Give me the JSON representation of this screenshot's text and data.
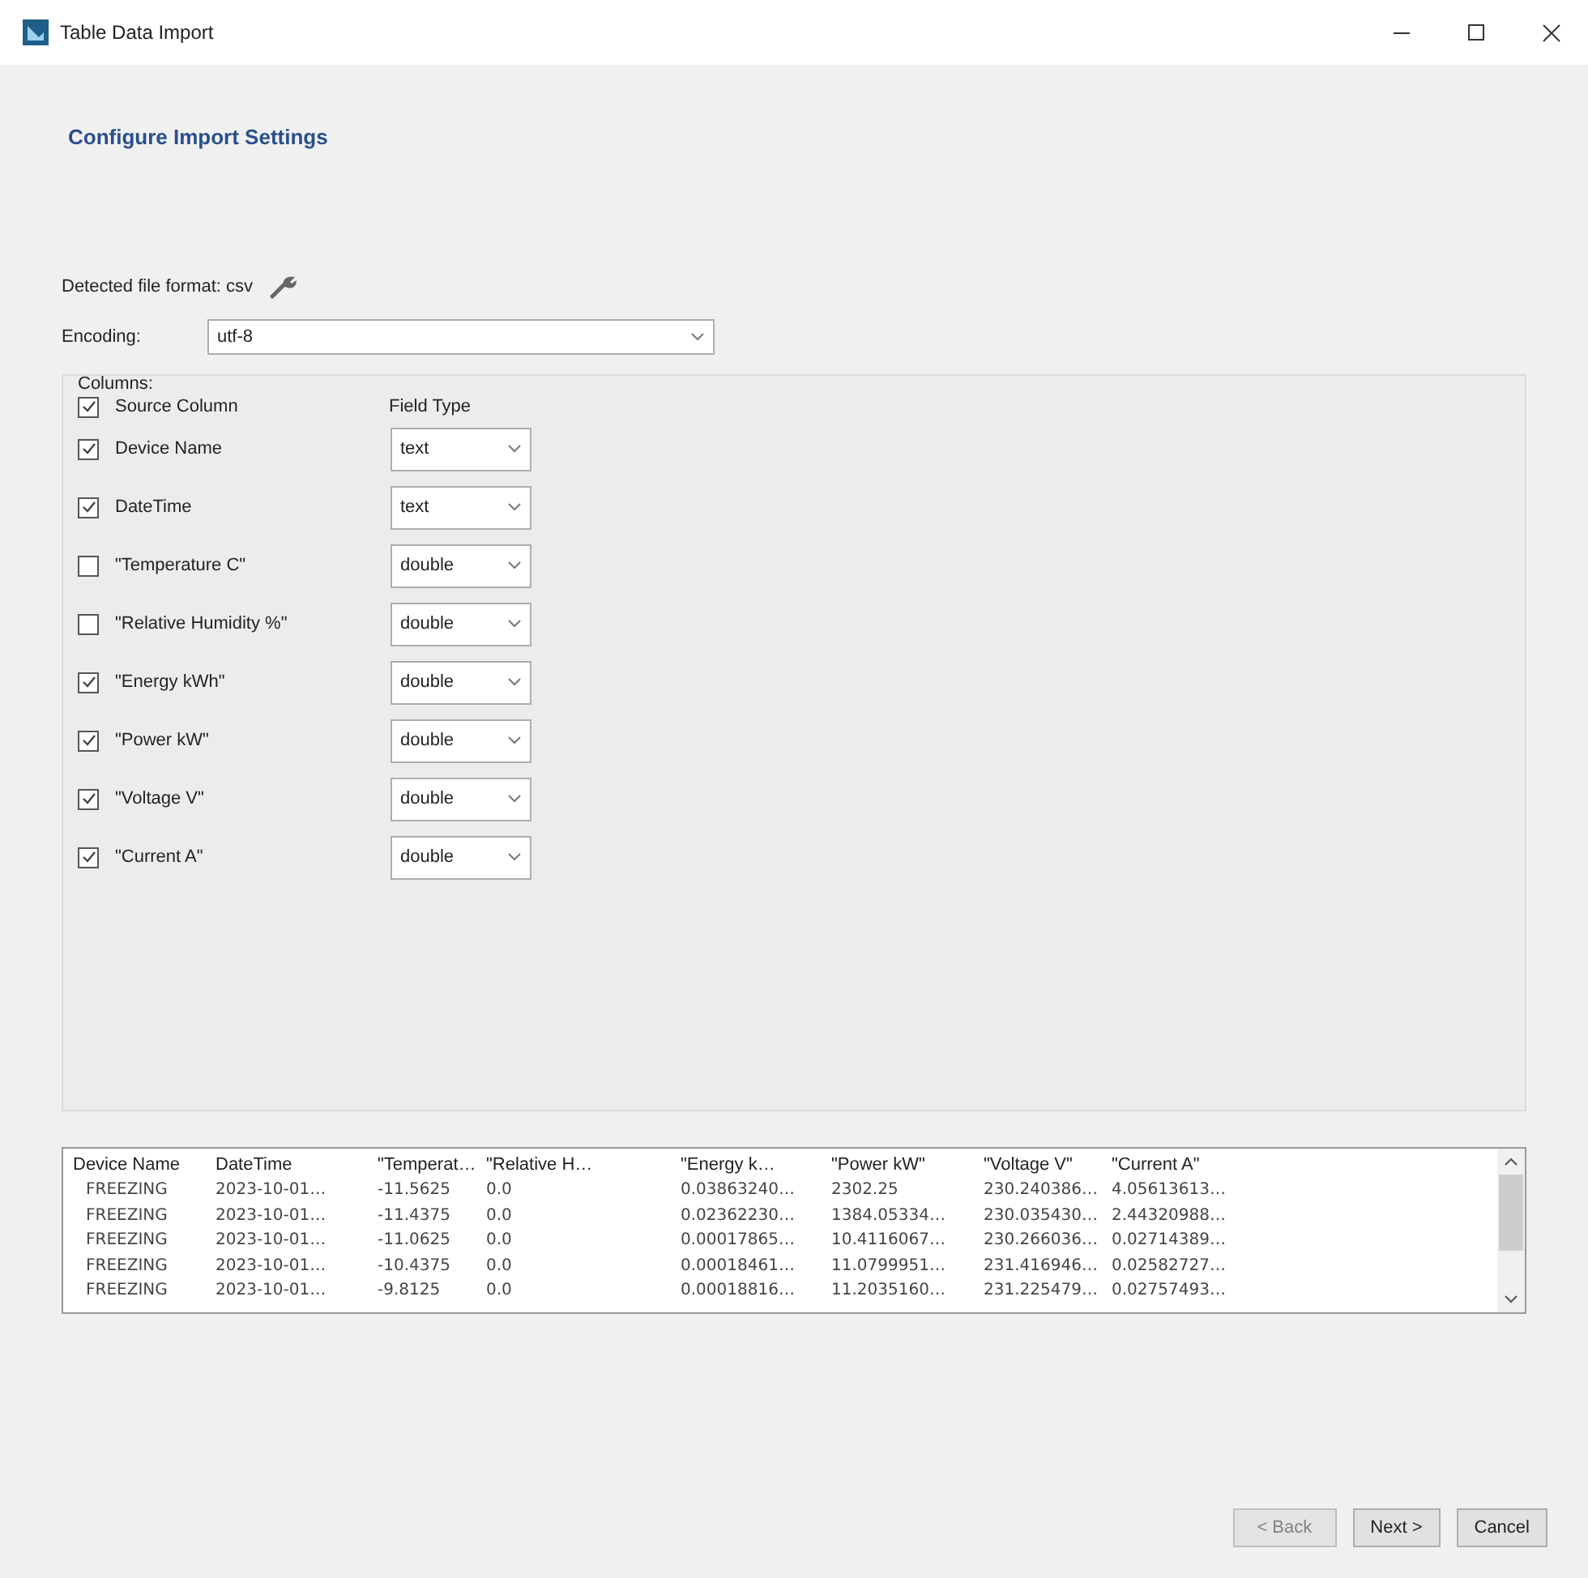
{
  "window": {
    "title": "Table Data Import"
  },
  "heading": "Configure Import Settings",
  "detected_format": "Detected file format: csv",
  "encoding": {
    "label": "Encoding:",
    "value": "utf-8"
  },
  "columns_group": {
    "title": "Columns:",
    "header": {
      "label": "Source Column",
      "checked": true,
      "type_heading": "Field Type"
    },
    "items": [
      {
        "label": "Device Name",
        "checked": true,
        "type": "text"
      },
      {
        "label": "DateTime",
        "checked": true,
        "type": "text"
      },
      {
        "label": "\"Temperature C\"",
        "checked": false,
        "type": "double"
      },
      {
        "label": "\"Relative Humidity %\"",
        "checked": false,
        "type": "double"
      },
      {
        "label": "\"Energy kWh\"",
        "checked": true,
        "type": "double"
      },
      {
        "label": "\"Power kW\"",
        "checked": true,
        "type": "double"
      },
      {
        "label": "\"Voltage V\"",
        "checked": true,
        "type": "double"
      },
      {
        "label": "\"Current A\"",
        "checked": true,
        "type": "double"
      }
    ]
  },
  "preview": {
    "columns": [
      "Device Name",
      "DateTime",
      "\"Temperat…",
      "\"Relative H…",
      "\"Energy k…",
      "\"Power kW\"",
      "\"Voltage V\"",
      "\"Current A\""
    ],
    "rows": [
      [
        "FREEZING",
        "2023-10-01…",
        "-11.5625",
        "0.0",
        "0.03863240…",
        "2302.25",
        "230.240386…",
        "4.05613613…"
      ],
      [
        "FREEZING",
        "2023-10-01…",
        "-11.4375",
        "0.0",
        "0.02362230…",
        "1384.05334…",
        "230.035430…",
        "2.44320988…"
      ],
      [
        "FREEZING",
        "2023-10-01…",
        "-11.0625",
        "0.0",
        "0.00017865…",
        "10.4116067…",
        "230.266036…",
        "0.02714389…"
      ],
      [
        "FREEZING",
        "2023-10-01…",
        "-10.4375",
        "0.0",
        "0.00018461…",
        "11.0799951…",
        "231.416946…",
        "0.02582727…"
      ],
      [
        "FREEZING",
        "2023-10-01…",
        "-9.8125",
        "0.0",
        "0.00018816…",
        "11.2035160…",
        "231.225479…",
        "0.02757493…"
      ]
    ]
  },
  "buttons": [
    {
      "label": "< Back",
      "disabled": true
    },
    {
      "label": "Next >",
      "disabled": false
    },
    {
      "label": "Cancel",
      "disabled": false
    }
  ]
}
